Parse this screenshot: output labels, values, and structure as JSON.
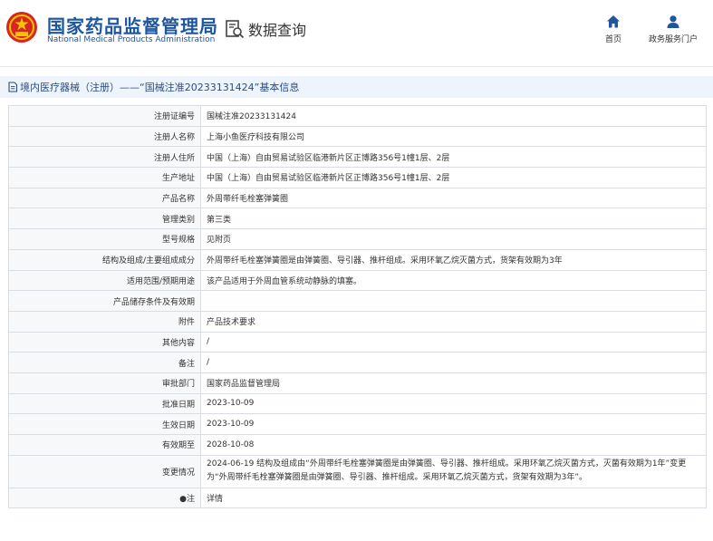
{
  "header": {
    "logo_cn": "国家药品监督管理局",
    "logo_en": "National Medical Products Administration",
    "query_label": "数据查询",
    "nav": [
      {
        "label": "首页",
        "icon": "home-icon"
      },
      {
        "label": "政务服务门户",
        "icon": "user-icon"
      }
    ]
  },
  "section": {
    "title": "境内医疗器械（注册）——“国械注准20233131424”基本信息"
  },
  "rows": [
    {
      "label": "注册证编号",
      "value": "国械注准20233131424"
    },
    {
      "label": "注册人名称",
      "value": "上海小鱼医疗科技有限公司"
    },
    {
      "label": "注册人住所",
      "value": "中国（上海）自由贸易试验区临港新片区正博路356号1幢1层、2层"
    },
    {
      "label": "生产地址",
      "value": "中国（上海）自由贸易试验区临港新片区正博路356号1幢1层、2层"
    },
    {
      "label": "产品名称",
      "value": "外周带纤毛栓塞弹簧圈"
    },
    {
      "label": "管理类别",
      "value": "第三类"
    },
    {
      "label": "型号规格",
      "value": "见附页"
    },
    {
      "label": "结构及组成/主要组成成分",
      "value": "外周带纤毛栓塞弹簧圈是由弹簧圈、导引器、推杆组成。采用环氧乙烷灭菌方式，货架有效期为3年"
    },
    {
      "label": "适用范围/预期用途",
      "value": "该产品适用于外周血管系统动静脉的填塞。"
    },
    {
      "label": "产品储存条件及有效期",
      "value": ""
    },
    {
      "label": "附件",
      "value": "产品技术要求"
    },
    {
      "label": "其他内容",
      "value": "/"
    },
    {
      "label": "备注",
      "value": "/"
    },
    {
      "label": "审批部门",
      "value": "国家药品监督管理局"
    },
    {
      "label": "批准日期",
      "value": "2023-10-09"
    },
    {
      "label": "生效日期",
      "value": "2023-10-09"
    },
    {
      "label": "有效期至",
      "value": "2028-10-08"
    },
    {
      "label": "变更情况",
      "value": "2024-06-19 结构及组成由“外周带纤毛栓塞弹簧圈是由弹簧圈、导引器、推杆组成。采用环氧乙烷灭菌方式，灭菌有效期为1年”变更为“外周带纤毛栓塞弹簧圈是由弹簧圈、导引器、推杆组成。采用环氧乙烷灭菌方式，货架有效期为3年”。"
    },
    {
      "label": "●注",
      "value": "详情",
      "is_link": true
    }
  ]
}
